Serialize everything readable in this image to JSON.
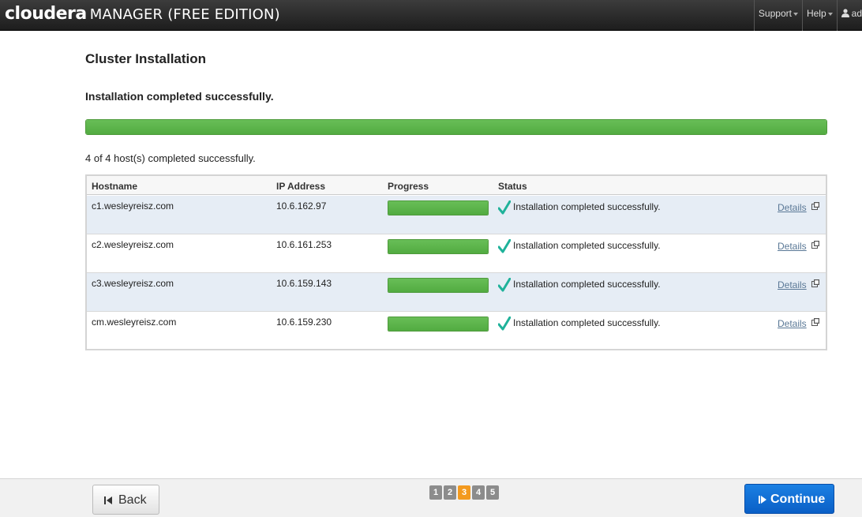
{
  "header": {
    "logo": "cloudera",
    "product": "MANAGER (FREE EDITION)",
    "nav": {
      "support": "Support",
      "help": "Help",
      "user": "ad"
    }
  },
  "page": {
    "title": "Cluster Installation",
    "status_heading": "Installation completed successfully.",
    "overall_progress": 1.0,
    "summary": "4 of 4 host(s) completed successfully."
  },
  "table": {
    "columns": [
      "Hostname",
      "IP Address",
      "Progress",
      "Status"
    ],
    "rows": [
      {
        "hostname": "c1.wesleyreisz.com",
        "ip": "10.6.162.97",
        "progress": 1.0,
        "status": "Installation completed successfully.",
        "details": "Details"
      },
      {
        "hostname": "c2.wesleyreisz.com",
        "ip": "10.6.161.253",
        "progress": 1.0,
        "status": "Installation completed successfully.",
        "details": "Details"
      },
      {
        "hostname": "c3.wesleyreisz.com",
        "ip": "10.6.159.143",
        "progress": 1.0,
        "status": "Installation completed successfully.",
        "details": "Details"
      },
      {
        "hostname": "cm.wesleyreisz.com",
        "ip": "10.6.159.230",
        "progress": 1.0,
        "status": "Installation completed successfully.",
        "details": "Details"
      }
    ]
  },
  "footer": {
    "back_label": "Back",
    "continue_label": "Continue",
    "steps": [
      "1",
      "2",
      "3",
      "4",
      "5"
    ],
    "current_step": "3"
  },
  "colors": {
    "progress_green": "#5cb54a",
    "check_teal": "#1fb29a",
    "continue_blue": "#0a6fd8",
    "active_step": "#f39a1f",
    "topbar": "#2b2b2b"
  },
  "icons": {
    "status": "check-icon",
    "details": "external-link-icon",
    "back": "skip-back-icon",
    "continue": "skip-forward-icon",
    "user": "user-icon"
  }
}
